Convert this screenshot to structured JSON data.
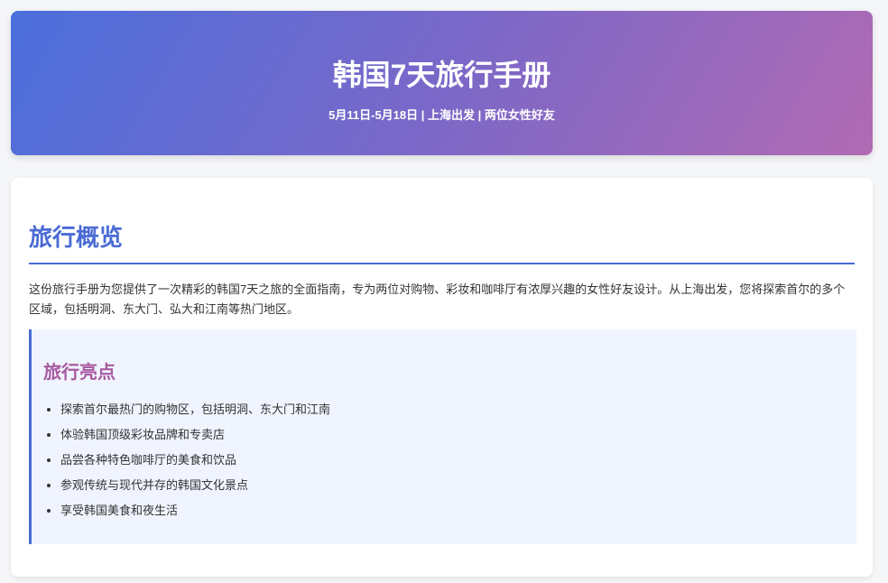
{
  "header": {
    "title": "韩国7天旅行手册",
    "subtitle": "5月11日-5月18日 | 上海出发 | 两位女性好友"
  },
  "overview": {
    "title": "旅行概览",
    "intro": "这份旅行手册为您提供了一次精彩的韩国7天之旅的全面指南，专为两位对购物、彩妆和咖啡厅有浓厚兴趣的女性好友设计。从上海出发，您将探索首尔的多个区域，包括明洞、东大门、弘大和江南等热门地区。"
  },
  "highlights": {
    "title": "旅行亮点",
    "items": [
      "探索首尔最热门的购物区，包括明洞、东大门和江南",
      "体验韩国顶级彩妆品牌和专卖店",
      "品尝各种特色咖啡厅的美食和饮品",
      "参观传统与现代并存的韩国文化景点",
      "享受韩国美食和夜生活"
    ]
  },
  "colors": {
    "header_gradient_start": "#4b6fdc",
    "header_gradient_end": "#b16ab3",
    "section_title": "#4a6bd5",
    "highlights_title": "#a7599f",
    "highlights_bg": "#f0f4ff"
  }
}
